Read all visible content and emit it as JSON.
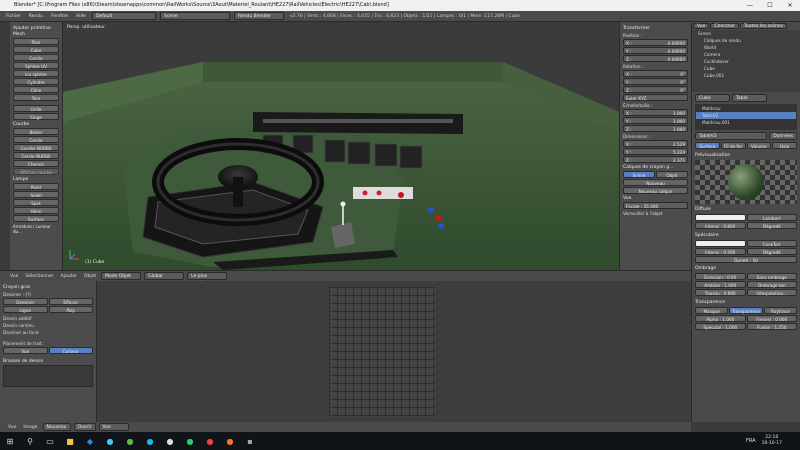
{
  "window": {
    "title": "Blender* [C:\\Program Files (x86)\\Steam\\steamapps\\common\\RailWorks\\Source\\3Aout\\Materiel_Roulant\\HE227\\RailVehicles\\Electric\\HE227\\Cab\\.blend]"
  },
  "info": {
    "menus": [
      "Fichier",
      "Rendu",
      "Fenêtre",
      "Aide"
    ],
    "layout": "Default",
    "scene": "Scene",
    "engine": "Rendu Blender",
    "stats": "v2.76 | Verts : 4,668 | Faces : 4,035 | Tris : 8,623 | Objets : 1/21 | Lampes : 0/1 | Mem :117.26M | Cube"
  },
  "toolshelf": {
    "sections": [
      {
        "title": "Ajouter primitive",
        "sub": "Mesh",
        "items": [
          "Plan",
          "Cube",
          "Cercle",
          "Sphère UV",
          "Ico sphère",
          "Cylindre",
          "Cône",
          "Tore"
        ]
      },
      {
        "title": "",
        "sub": "",
        "items": [
          "Grille",
          "Singe"
        ]
      },
      {
        "title": "",
        "sub": "Courbe",
        "items": [
          "Bézier",
          "Cercle"
        ]
      },
      {
        "title": "",
        "sub": "",
        "items": [
          "Courbe NURBS",
          "Cercle NURBS",
          "Chemin"
        ]
      },
      {
        "title": "",
        "sub": "",
        "items": [
          "Afficher courbe"
        ]
      },
      {
        "title": "",
        "sub": "Lampe",
        "items": [
          "Point",
          "Soleil",
          "Spot",
          "Hémi",
          "Surface"
        ]
      }
    ],
    "footer": "Armature / curseur du..."
  },
  "viewport": {
    "view_label": "Persp. utilisateur",
    "object_label": "(1) Cube"
  },
  "transform": {
    "title": "Transformer",
    "position": {
      "label": "Position :",
      "x": "0.00000",
      "y": "0.00000",
      "z": "0.00000"
    },
    "rotation": {
      "label": "Rotation :",
      "x": "0°",
      "y": "0°",
      "z": "0°"
    },
    "mode": "Euler XYZ",
    "scale": {
      "label": "Échelle/taille :",
      "x": "1.000",
      "y": "1.000",
      "z": "1.000"
    },
    "dimensions": {
      "label": "Dimensions :",
      "x": "2.529",
      "y": "5.224",
      "z": "2.371"
    },
    "grease_title": "Calques de crayon g...",
    "scene_btn": "Scène",
    "object_btn": "Objet",
    "new_btn": "Nouveau",
    "new_layer_btn": "Nouveau calque",
    "view_title": "Vue",
    "focal": "Focale : 35.000",
    "lock": "Verrouiller à l'objet"
  },
  "outliner": {
    "tabs": [
      "Vue",
      "Chercher",
      "Toutes les scènes"
    ],
    "items": [
      "Scene",
      "Calques de rendu",
      "World",
      "Camera",
      "Cockhdover",
      "Cube",
      "Cube.001"
    ]
  },
  "properties": {
    "object": "Cube",
    "material": "Table",
    "slots": [
      "Matériau",
      "TableV2",
      "Matériau.001"
    ],
    "mat_name": "TableV2",
    "mat_users": "Données",
    "tabs": [
      "Surface",
      "Fil de fer",
      "Volume",
      "Halo"
    ],
    "preview_title": "Prévisualisation",
    "diffuse_title": "Diffuse",
    "diffuse_shader": "Lambert",
    "intensity_d": "Intensi : 0.800",
    "ramp": "Dégradé",
    "spec_title": "Spéculaire",
    "spec_shader": "CookTorr",
    "intensity_s": "Intensi : 0.500",
    "hardness": "Dureté : 50",
    "shading_title": "Ombrage",
    "emission": "Émission : 0.00",
    "ambient": "Ambian : 1.000",
    "translu": "Translu : 0.000",
    "shadeless": "Sans ombrage",
    "tangent": "Ombrage tan",
    "cubic": "Interpolation...",
    "transp_title": "Transparence",
    "transp_tabs": [
      "Masque",
      "Transparence",
      "Raytrace"
    ],
    "alpha": "Alpha : 1.000",
    "fresnel": "Fresnel : 0.000",
    "specular": "Spéculai : 1.000",
    "blend": "Fusion : 1.250"
  },
  "v3d_header": {
    "menus": [
      "Vue",
      "Sélectionner",
      "Ajouter",
      "Objet"
    ],
    "mode": "Mode Objet",
    "pivot": "Global",
    "snap": "Le plus proche"
  },
  "grease": {
    "title": "Crayon gras",
    "draw_label": "Dessiner : (?)",
    "btns": [
      "Dessiner",
      "Effacer",
      "Ligne",
      "Poly"
    ],
    "checks": [
      "Dessin additif",
      "Dessin continu",
      "Dessiner au fond"
    ],
    "stroke_label": "Placement de trait :",
    "view_btn": "Vue",
    "cursor_btn": "Curseur",
    "brush_title": "Brosses de dessin"
  },
  "uv_header": {
    "menus": [
      "Vue",
      "Image"
    ],
    "new_btn": "Nouveau",
    "open_btn": "Ouvrir",
    "view": "Vue"
  },
  "taskbar": {
    "lang": "FRA",
    "time": "22:18",
    "date": "18-10-17"
  }
}
